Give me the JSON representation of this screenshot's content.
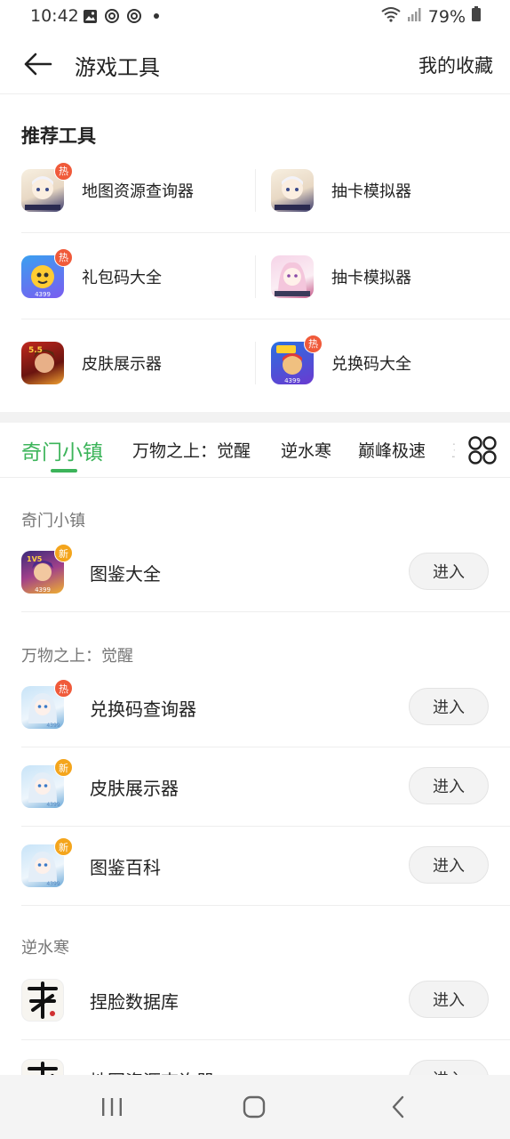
{
  "status_bar": {
    "time": "10:42",
    "battery": "79%",
    "icons": [
      "gallery-icon",
      "sync-icon",
      "sync-icon",
      "dot-icon",
      "wifi-icon",
      "signal-icon",
      "battery-icon"
    ]
  },
  "header": {
    "title": "游戏工具",
    "favorites_label": "我的收藏"
  },
  "recommend": {
    "title": "推荐工具",
    "items": [
      {
        "label": "地图资源查询器",
        "badge": "热",
        "icon": "genshin-paimon-icon"
      },
      {
        "label": "抽卡模拟器",
        "badge": "",
        "icon": "genshin-paimon-icon"
      },
      {
        "label": "礼包码大全",
        "badge": "热",
        "icon": "4399-mascot-icon"
      },
      {
        "label": "抽卡模拟器",
        "badge": "",
        "icon": "anime-girl-icon"
      },
      {
        "label": "皮肤展示器",
        "badge": "",
        "icon": "hero-warrior-icon"
      },
      {
        "label": "兑换码大全",
        "badge": "热",
        "icon": "subway-runner-icon"
      }
    ]
  },
  "tabs": [
    {
      "label": "奇门小镇",
      "active": true
    },
    {
      "label": "万物之上：觉醒",
      "active": false
    },
    {
      "label": "逆水寒",
      "active": false
    },
    {
      "label": "巅峰极速",
      "active": false
    },
    {
      "label": "王",
      "active": false
    }
  ],
  "groups": [
    {
      "title": "奇门小镇",
      "items": [
        {
          "label": "图鉴大全",
          "badge": "新",
          "button": "进入"
        }
      ]
    },
    {
      "title": "万物之上：觉醒",
      "items": [
        {
          "label": "兑换码查询器",
          "badge": "热",
          "button": "进入"
        },
        {
          "label": "皮肤展示器",
          "badge": "新",
          "button": "进入"
        },
        {
          "label": "图鉴百科",
          "badge": "新",
          "button": "进入"
        }
      ]
    },
    {
      "title": "逆水寒",
      "items": [
        {
          "label": "捏脸数据库",
          "badge": "",
          "button": "进入"
        },
        {
          "label": "地图资源查询器",
          "badge": "",
          "button": "进入"
        }
      ]
    }
  ],
  "colors": {
    "accent": "#3cb45a",
    "hot_badge": "#f05a3a",
    "new_badge": "#f4a51c"
  }
}
